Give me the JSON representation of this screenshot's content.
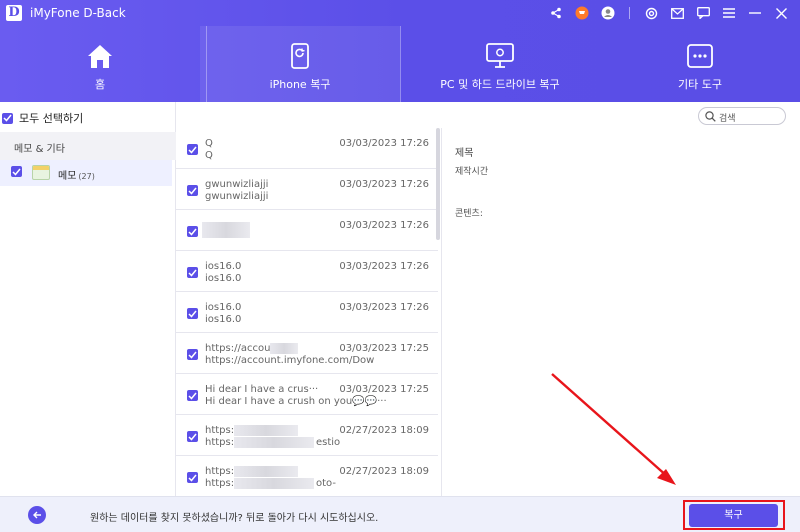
{
  "app": {
    "title": "iMyFone D-Back",
    "logo_letter": "D"
  },
  "titlebar_icons": [
    "share-icon",
    "cart-icon",
    "account-icon",
    "settings-icon",
    "mail-icon",
    "chat-icon",
    "menu-icon",
    "minimize-icon",
    "close-icon"
  ],
  "nav": {
    "tabs": [
      {
        "label": "홈",
        "icon": "home-icon"
      },
      {
        "label": "iPhone 복구",
        "icon": "phone-recover-icon"
      },
      {
        "label": "PC 및 하드 드라이브 복구",
        "icon": "pc-recover-icon"
      },
      {
        "label": "기타 도구",
        "icon": "more-tools-icon"
      }
    ],
    "active": 1
  },
  "left": {
    "select_all": "모두 선택하기",
    "category": "메모 & 기타",
    "memo_label": "메모",
    "memo_count": "(27)"
  },
  "search": {
    "placeholder": "검색"
  },
  "list": [
    {
      "l1": "Q",
      "l2": "Q",
      "date": "03/03/2023 17:26"
    },
    {
      "l1": "gwunwizliajji",
      "l2": "gwunwizliajji",
      "date": "03/03/2023 17:26"
    },
    {
      "l1": "",
      "l2": "",
      "date": "03/03/2023 17:26"
    },
    {
      "l1": "ios16.0",
      "l2": "ios16.0",
      "date": "03/03/2023 17:26"
    },
    {
      "l1": "ios16.0",
      "l2": "ios16.0",
      "date": "03/03/2023 17:26"
    },
    {
      "l1": "https://accou",
      "l2": "https://account.imyfone.com/Dow",
      "date": "03/03/2023 17:25"
    },
    {
      "l1": "Hi dear I have a crus···",
      "l2": "Hi dear I have a crush on you💬💬···",
      "date": "03/03/2023 17:25"
    },
    {
      "l1": "https://",
      "l2": "https://",
      "l2_tail": "estio",
      "date": "02/27/2023 18:09"
    },
    {
      "l1": "https://",
      "l2": "https://",
      "l2_tail": "oto-",
      "date": "02/27/2023 18:09"
    }
  ],
  "detail": {
    "title": "제목",
    "created": "제작시간",
    "content": "콘텐츠:"
  },
  "footer": {
    "hint": "원하는 데이터를 찾지 못하셨습니까? 뒤로 돌아가 다시 시도하십시오.",
    "recover_label": "복구"
  },
  "colors": {
    "accent": "#5b4fe8",
    "highlight": "#e8151b"
  }
}
